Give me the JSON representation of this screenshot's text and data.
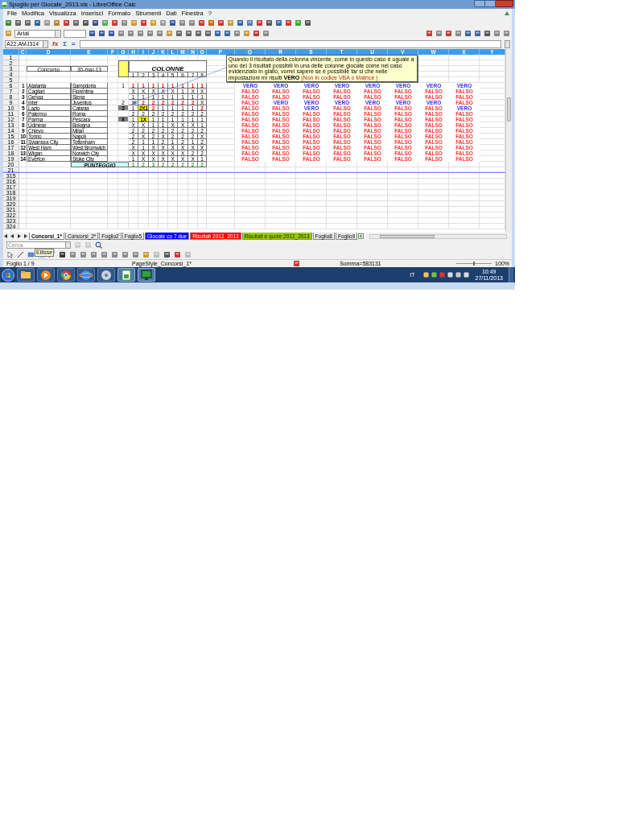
{
  "window": {
    "title": "Spoglio per Giocate_2013.xls - LibreOffice Calc"
  },
  "menu": [
    "File",
    "Modifica",
    "Visualizza",
    "Inserisci",
    "Formato",
    "Strumenti",
    "Dati",
    "Finestra",
    "?"
  ],
  "font_box": {
    "value": "Arial"
  },
  "formula_bar": {
    "name_box": "A22:AMJ314",
    "buttons": [
      "fx",
      "Σ",
      "="
    ]
  },
  "columns": [
    "C",
    "D",
    "E",
    "F",
    "G",
    "H",
    "I",
    "J",
    "K",
    "L",
    "M",
    "N",
    "O",
    "P",
    "Q",
    "R",
    "S",
    "T",
    "U",
    "V",
    "W",
    "X",
    "Y"
  ],
  "row_numbers": [
    "1",
    "2",
    "3",
    "4",
    "5",
    "6",
    "7",
    "8",
    "9",
    "10",
    "11",
    "12",
    "13",
    "14",
    "15",
    "16",
    "17",
    "18",
    "19",
    "20",
    "21",
    "315",
    "316",
    "317",
    "318",
    "319",
    "320",
    "321",
    "322",
    "323",
    "324"
  ],
  "concorso": {
    "label": "Concorso",
    "date": "30-mar-13"
  },
  "colonne": {
    "title": "COLONNE",
    "numbers": [
      "1",
      "2",
      "3",
      "4",
      "5",
      "6",
      "7",
      "8"
    ]
  },
  "matches": [
    {
      "number": "1",
      "home": "Atalanta",
      "away": "Sampdoria",
      "result": "1",
      "marked": false,
      "picks": [
        {
          "text": "1",
          "kind": "red"
        },
        {
          "text": "1",
          "kind": "red"
        },
        {
          "text": "1",
          "kind": "red"
        },
        {
          "text": "1",
          "kind": "red"
        },
        {
          "text": "1",
          "kind": "red"
        },
        {
          "text": "1",
          "kind": "red"
        },
        {
          "text": "1",
          "kind": "red"
        },
        {
          "text": "1",
          "kind": "red"
        }
      ],
      "checks": [
        {
          "text": "VERO",
          "positive": true
        },
        {
          "text": "VERO",
          "positive": true
        },
        {
          "text": "VERO",
          "positive": true
        },
        {
          "text": "VERO",
          "positive": true
        },
        {
          "text": "VERO",
          "positive": true
        },
        {
          "text": "VERO",
          "positive": true
        },
        {
          "text": "VERO",
          "positive": true
        },
        {
          "text": "VERO",
          "positive": true
        }
      ]
    },
    {
      "number": "2",
      "home": "Cagliari",
      "away": "Fiorentina",
      "marked": false,
      "picks": [
        {
          "text": "X",
          "kind": "plain"
        },
        {
          "text": "X",
          "kind": "plain"
        },
        {
          "text": "X",
          "kind": "plain"
        },
        {
          "text": "X",
          "kind": "plain"
        },
        {
          "text": "X",
          "kind": "plain"
        },
        {
          "text": "1",
          "kind": "plain"
        },
        {
          "text": "X",
          "kind": "plain"
        },
        {
          "text": "X",
          "kind": "plain"
        }
      ],
      "checks": [
        {
          "text": "FALSO",
          "positive": false
        },
        {
          "text": "FALSO",
          "positive": false
        },
        {
          "text": "FALSO",
          "positive": false
        },
        {
          "text": "FALSO",
          "positive": false
        },
        {
          "text": "FALSO",
          "positive": false
        },
        {
          "text": "FALSO",
          "positive": false
        },
        {
          "text": "FALSO",
          "positive": false
        },
        {
          "text": "FALSO",
          "positive": false
        }
      ]
    },
    {
      "number": "3",
      "home": "Genoa",
      "away": "Siena",
      "marked": false,
      "picks": [
        {
          "text": "1",
          "kind": "plain"
        },
        {
          "text": "1",
          "kind": "plain"
        },
        {
          "text": "1",
          "kind": "plain"
        },
        {
          "text": "1",
          "kind": "plain"
        },
        {
          "text": "1",
          "kind": "plain"
        },
        {
          "text": "1",
          "kind": "plain"
        },
        {
          "text": "1",
          "kind": "plain"
        },
        {
          "text": "1",
          "kind": "plain"
        }
      ],
      "checks": [
        {
          "text": "FALSO",
          "positive": false
        },
        {
          "text": "FALSO",
          "positive": false
        },
        {
          "text": "FALSO",
          "positive": false
        },
        {
          "text": "FALSO",
          "positive": false
        },
        {
          "text": "FALSO",
          "positive": false
        },
        {
          "text": "FALSO",
          "positive": false
        },
        {
          "text": "FALSO",
          "positive": false
        },
        {
          "text": "FALSO",
          "positive": false
        }
      ]
    },
    {
      "number": "4",
      "home": "Inter",
      "away": "Juventus",
      "result": "2",
      "marked": false,
      "picks": [
        {
          "text": "X",
          "kind": "plain"
        },
        {
          "text": "2",
          "kind": "red"
        },
        {
          "text": "2",
          "kind": "red"
        },
        {
          "text": "2",
          "kind": "red"
        },
        {
          "text": "2",
          "kind": "red"
        },
        {
          "text": "2",
          "kind": "red"
        },
        {
          "text": "2",
          "kind": "red"
        },
        {
          "text": "X",
          "kind": "plain"
        }
      ],
      "checks": [
        {
          "text": "FALSO",
          "positive": false
        },
        {
          "text": "VERO",
          "positive": true
        },
        {
          "text": "VERO",
          "positive": true
        },
        {
          "text": "VERO",
          "positive": true
        },
        {
          "text": "VERO",
          "positive": true
        },
        {
          "text": "VERO",
          "positive": true
        },
        {
          "text": "VERO",
          "positive": true
        },
        {
          "text": "FALSO",
          "positive": false
        }
      ]
    },
    {
      "number": "5",
      "home": "Lazio",
      "away": "Catania",
      "result": "2",
      "marked": true,
      "picks": [
        {
          "text": "1",
          "kind": "plain"
        },
        {
          "text": "2X1",
          "kind": "yellow"
        },
        {
          "text": "2",
          "kind": "red"
        },
        {
          "text": "1",
          "kind": "plain"
        },
        {
          "text": "1",
          "kind": "plain"
        },
        {
          "text": "1",
          "kind": "plain"
        },
        {
          "text": "1",
          "kind": "plain"
        },
        {
          "text": "2",
          "kind": "red"
        }
      ],
      "checks": [
        {
          "text": "FALSO",
          "positive": false
        },
        {
          "text": "FALSO",
          "positive": false
        },
        {
          "text": "VERO",
          "positive": true
        },
        {
          "text": "FALSO",
          "positive": false
        },
        {
          "text": "FALSO",
          "positive": false
        },
        {
          "text": "FALSO",
          "positive": false
        },
        {
          "text": "FALSO",
          "positive": false
        },
        {
          "text": "VERO",
          "positive": true
        }
      ]
    },
    {
      "number": "6",
      "home": "Palermo",
      "away": "Roma",
      "marked": false,
      "picks": [
        {
          "text": "2",
          "kind": "plain"
        },
        {
          "text": "2",
          "kind": "plain"
        },
        {
          "text": "2",
          "kind": "plain"
        },
        {
          "text": "2",
          "kind": "plain"
        },
        {
          "text": "2",
          "kind": "plain"
        },
        {
          "text": "2",
          "kind": "plain"
        },
        {
          "text": "2",
          "kind": "plain"
        },
        {
          "text": "2",
          "kind": "plain"
        }
      ],
      "checks": [
        {
          "text": "FALSO",
          "positive": false
        },
        {
          "text": "FALSO",
          "positive": false
        },
        {
          "text": "FALSO",
          "positive": false
        },
        {
          "text": "FALSO",
          "positive": false
        },
        {
          "text": "FALSO",
          "positive": false
        },
        {
          "text": "FALSO",
          "positive": false
        },
        {
          "text": "FALSO",
          "positive": false
        },
        {
          "text": "FALSO",
          "positive": false
        }
      ]
    },
    {
      "number": "7",
      "home": "Parma",
      "away": "Pescara",
      "result": "X",
      "marked": true,
      "picks": [
        {
          "text": "1",
          "kind": "plain"
        },
        {
          "text": "1X",
          "kind": "yellow"
        },
        {
          "text": "1",
          "kind": "plain"
        },
        {
          "text": "1",
          "kind": "plain"
        },
        {
          "text": "1",
          "kind": "plain"
        },
        {
          "text": "1",
          "kind": "plain"
        },
        {
          "text": "1",
          "kind": "plain"
        },
        {
          "text": "1",
          "kind": "plain"
        }
      ],
      "checks": [
        {
          "text": "FALSO",
          "positive": false
        },
        {
          "text": "FALSO",
          "positive": false
        },
        {
          "text": "FALSO",
          "positive": false
        },
        {
          "text": "FALSO",
          "positive": false
        },
        {
          "text": "FALSO",
          "positive": false
        },
        {
          "text": "FALSO",
          "positive": false
        },
        {
          "text": "FALSO",
          "positive": false
        },
        {
          "text": "FALSO",
          "positive": false
        }
      ]
    },
    {
      "number": "8",
      "home": "Udinese",
      "away": "Bologna",
      "marked": false,
      "picks": [
        {
          "text": "X",
          "kind": "plain"
        },
        {
          "text": "X",
          "kind": "plain"
        },
        {
          "text": "1",
          "kind": "plain"
        },
        {
          "text": "1",
          "kind": "plain"
        },
        {
          "text": "X",
          "kind": "plain"
        },
        {
          "text": "X",
          "kind": "plain"
        },
        {
          "text": "X",
          "kind": "plain"
        },
        {
          "text": "1",
          "kind": "plain"
        }
      ],
      "checks": [
        {
          "text": "FALSO",
          "positive": false
        },
        {
          "text": "FALSO",
          "positive": false
        },
        {
          "text": "FALSO",
          "positive": false
        },
        {
          "text": "FALSO",
          "positive": false
        },
        {
          "text": "FALSO",
          "positive": false
        },
        {
          "text": "FALSO",
          "positive": false
        },
        {
          "text": "FALSO",
          "positive": false
        },
        {
          "text": "FALSO",
          "positive": false
        }
      ]
    },
    {
      "number": "9",
      "home": "Chievo",
      "away": "Milan",
      "marked": false,
      "picks": [
        {
          "text": "2",
          "kind": "plain"
        },
        {
          "text": "2",
          "kind": "plain"
        },
        {
          "text": "2",
          "kind": "plain"
        },
        {
          "text": "2",
          "kind": "plain"
        },
        {
          "text": "2",
          "kind": "plain"
        },
        {
          "text": "2",
          "kind": "plain"
        },
        {
          "text": "2",
          "kind": "plain"
        },
        {
          "text": "2",
          "kind": "plain"
        }
      ],
      "checks": [
        {
          "text": "FALSO",
          "positive": false
        },
        {
          "text": "FALSO",
          "positive": false
        },
        {
          "text": "FALSO",
          "positive": false
        },
        {
          "text": "FALSO",
          "positive": false
        },
        {
          "text": "FALSO",
          "positive": false
        },
        {
          "text": "FALSO",
          "positive": false
        },
        {
          "text": "FALSO",
          "positive": false
        },
        {
          "text": "FALSO",
          "positive": false
        }
      ]
    },
    {
      "number": "10",
      "home": "Torino",
      "away": "Napoli",
      "marked": false,
      "picks": [
        {
          "text": "2",
          "kind": "plain"
        },
        {
          "text": "X",
          "kind": "plain"
        },
        {
          "text": "2",
          "kind": "plain"
        },
        {
          "text": "X",
          "kind": "plain"
        },
        {
          "text": "2",
          "kind": "plain"
        },
        {
          "text": "2",
          "kind": "plain"
        },
        {
          "text": "2",
          "kind": "plain"
        },
        {
          "text": "X",
          "kind": "plain"
        }
      ],
      "checks": [
        {
          "text": "FALSO",
          "positive": false
        },
        {
          "text": "FALSO",
          "positive": false
        },
        {
          "text": "FALSO",
          "positive": false
        },
        {
          "text": "FALSO",
          "positive": false
        },
        {
          "text": "FALSO",
          "positive": false
        },
        {
          "text": "FALSO",
          "positive": false
        },
        {
          "text": "FALSO",
          "positive": false
        },
        {
          "text": "FALSO",
          "positive": false
        }
      ]
    },
    {
      "number": "11",
      "home": "Swansea City",
      "away": "Tottenham",
      "marked": false,
      "picks": [
        {
          "text": "2",
          "kind": "plain"
        },
        {
          "text": "1",
          "kind": "plain"
        },
        {
          "text": "1",
          "kind": "plain"
        },
        {
          "text": "2",
          "kind": "plain"
        },
        {
          "text": "1",
          "kind": "plain"
        },
        {
          "text": "2",
          "kind": "plain"
        },
        {
          "text": "1",
          "kind": "plain"
        },
        {
          "text": "2",
          "kind": "plain"
        }
      ],
      "checks": [
        {
          "text": "FALSO",
          "positive": false
        },
        {
          "text": "FALSO",
          "positive": false
        },
        {
          "text": "FALSO",
          "positive": false
        },
        {
          "text": "FALSO",
          "positive": false
        },
        {
          "text": "FALSO",
          "positive": false
        },
        {
          "text": "FALSO",
          "positive": false
        },
        {
          "text": "FALSO",
          "positive": false
        },
        {
          "text": "FALSO",
          "positive": false
        }
      ]
    },
    {
      "number": "12",
      "home": "West Ham",
      "away": "West Bromwich",
      "marked": false,
      "picks": [
        {
          "text": "X",
          "kind": "plain"
        },
        {
          "text": "1",
          "kind": "plain"
        },
        {
          "text": "X",
          "kind": "plain"
        },
        {
          "text": "X",
          "kind": "plain"
        },
        {
          "text": "X",
          "kind": "plain"
        },
        {
          "text": "X",
          "kind": "plain"
        },
        {
          "text": "X",
          "kind": "plain"
        },
        {
          "text": "X",
          "kind": "plain"
        }
      ],
      "checks": [
        {
          "text": "FALSO",
          "positive": false
        },
        {
          "text": "FALSO",
          "positive": false
        },
        {
          "text": "FALSO",
          "positive": false
        },
        {
          "text": "FALSO",
          "positive": false
        },
        {
          "text": "FALSO",
          "positive": false
        },
        {
          "text": "FALSO",
          "positive": false
        },
        {
          "text": "FALSO",
          "positive": false
        },
        {
          "text": "FALSO",
          "positive": false
        }
      ]
    },
    {
      "number": "13",
      "home": "Wigan",
      "away": "Norwich City",
      "marked": false,
      "picks": [
        {
          "text": "X",
          "kind": "plain"
        },
        {
          "text": "X",
          "kind": "plain"
        },
        {
          "text": "X",
          "kind": "plain"
        },
        {
          "text": "X",
          "kind": "plain"
        },
        {
          "text": "X",
          "kind": "plain"
        },
        {
          "text": "X",
          "kind": "plain"
        },
        {
          "text": "2",
          "kind": "plain"
        },
        {
          "text": "2",
          "kind": "plain"
        }
      ],
      "checks": [
        {
          "text": "FALSO",
          "positive": false
        },
        {
          "text": "FALSO",
          "positive": false
        },
        {
          "text": "FALSO",
          "positive": false
        },
        {
          "text": "FALSO",
          "positive": false
        },
        {
          "text": "FALSO",
          "positive": false
        },
        {
          "text": "FALSO",
          "positive": false
        },
        {
          "text": "FALSO",
          "positive": false
        },
        {
          "text": "FALSO",
          "positive": false
        }
      ]
    },
    {
      "number": "14",
      "home": "Everton",
      "away": "Stoke City",
      "marked": false,
      "picks": [
        {
          "text": "1",
          "kind": "plain"
        },
        {
          "text": "X",
          "kind": "plain"
        },
        {
          "text": "X",
          "kind": "plain"
        },
        {
          "text": "X",
          "kind": "plain"
        },
        {
          "text": "X",
          "kind": "plain"
        },
        {
          "text": "X",
          "kind": "plain"
        },
        {
          "text": "X",
          "kind": "plain"
        },
        {
          "text": "1",
          "kind": "plain"
        }
      ],
      "checks": [
        {
          "text": "FALSO",
          "positive": false
        },
        {
          "text": "FALSO",
          "positive": false
        },
        {
          "text": "FALSO",
          "positive": false
        },
        {
          "text": "FALSO",
          "positive": false
        },
        {
          "text": "FALSO",
          "positive": false
        },
        {
          "text": "FALSO",
          "positive": false
        },
        {
          "text": "FALSO",
          "positive": false
        },
        {
          "text": "FALSO",
          "positive": false
        }
      ]
    }
  ],
  "score": {
    "label": "PUNTEGGIO",
    "values": [
      "1",
      "2",
      "3",
      "2",
      "2",
      "2",
      "2",
      "2"
    ]
  },
  "comment": {
    "text": "Quando il risultato della colonna vincente, come in questo caso è uguale a uno dei 3 risultati possibili in una delle colonne giocate come nel caso evidenziato in giallo, vorrei sapere se è possibile far si che nelle impostazioni mi risulti **VERO**",
    "note": "(Non in codice VBA o Matrice )"
  },
  "sheet_tabs": [
    {
      "label": "Concorsi_1*",
      "selected": true
    },
    {
      "label": "Concorsi_2*",
      "selected": false
    },
    {
      "label": "Foglio2",
      "selected": false
    },
    {
      "label": "Foglio5",
      "selected": false
    },
    {
      "label": "Giocate co 7 due",
      "selected": false,
      "color": "#0000ff"
    },
    {
      "label": "Risultati 2012_2013",
      "selected": false,
      "color": "#ff0000"
    },
    {
      "label": "Risultati e quote 2012_2013",
      "selected": false,
      "color": "#99cc00"
    },
    {
      "label": "Foglio8",
      "selected": false
    },
    {
      "label": "Foglio9",
      "selected": false
    }
  ],
  "find_bar": {
    "placeholder": "Cerca"
  },
  "tooltip": "Ellisse",
  "status_bar": {
    "sheet": "Foglio 1 / 9",
    "page_style": "PageStyle_Concorsi_1*",
    "sum": "Somma=583131",
    "zoom": {
      "level": 0.5,
      "reading": "100%"
    }
  },
  "taskbar": {
    "language": "IT",
    "time": "10:49",
    "date": "27/11/2013"
  }
}
